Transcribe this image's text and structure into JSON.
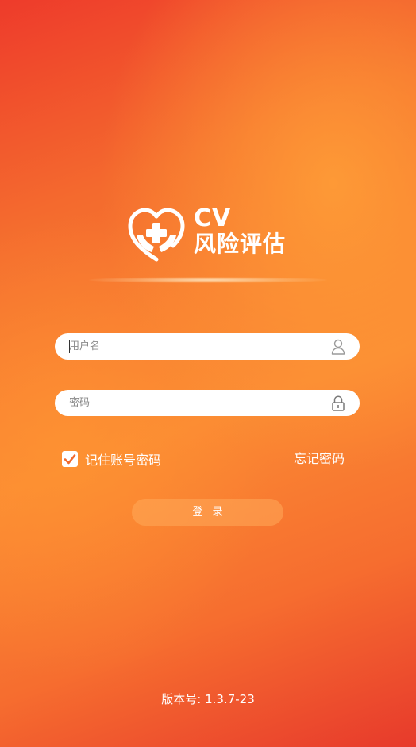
{
  "brand": {
    "logo_icon": "heart-hands-medical-cross-icon",
    "cv_text": "CV",
    "name_text": "风险评估"
  },
  "form": {
    "username_placeholder": "用户名",
    "username_value": "",
    "username_icon": "user-icon",
    "password_placeholder": "密码",
    "password_value": "",
    "password_icon": "lock-icon",
    "remember_label": "记住账号密码",
    "remember_checked": true,
    "forgot_label": "忘记密码",
    "login_label": "登录"
  },
  "footer": {
    "version_text": "版本号: 1.3.7-23"
  },
  "colors": {
    "background_start": "#ee3b2b",
    "background_mid": "#fb8a33",
    "accent_orange": "#f26a2e",
    "white": "#ffffff"
  }
}
